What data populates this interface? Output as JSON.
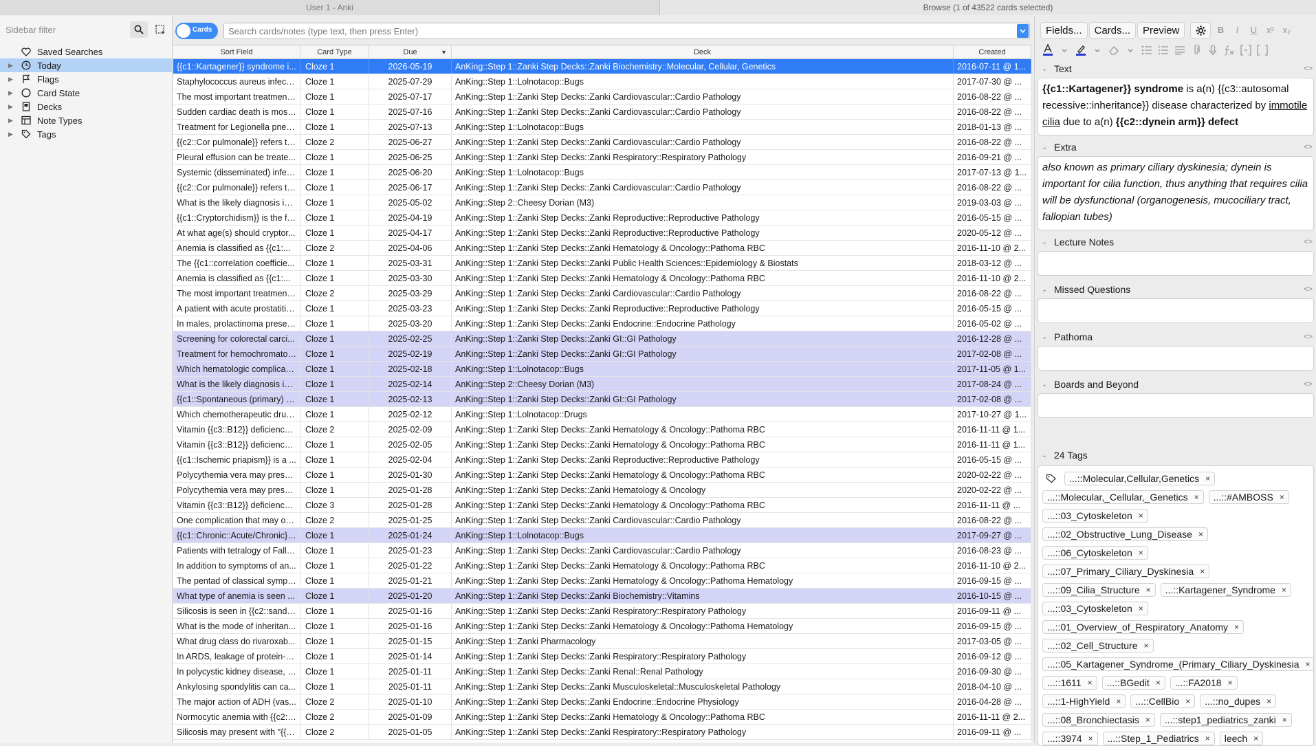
{
  "window": {
    "left_title": "User 1 - Anki",
    "right_title": "Browse (1 of 43522 cards selected)"
  },
  "sidebar": {
    "filter_placeholder": "Sidebar filter",
    "items": [
      {
        "label": "Saved Searches",
        "icon": "heart-icon",
        "arrow": false
      },
      {
        "label": "Today",
        "icon": "clock-icon",
        "arrow": true,
        "selected": true
      },
      {
        "label": "Flags",
        "icon": "flag-icon",
        "arrow": true
      },
      {
        "label": "Card State",
        "icon": "circle-icon",
        "arrow": true
      },
      {
        "label": "Decks",
        "icon": "deck-icon",
        "arrow": true
      },
      {
        "label": "Note Types",
        "icon": "note-types-icon",
        "arrow": true
      },
      {
        "label": "Tags",
        "icon": "tag-icon",
        "arrow": true
      }
    ]
  },
  "toolbar": {
    "toggle_label": "Cards",
    "search_placeholder": "Search cards/notes (type text, then press Enter)"
  },
  "table": {
    "columns": [
      "Sort Field",
      "Card Type",
      "Due",
      "Deck",
      "Created"
    ],
    "rows": [
      {
        "sort": "{{c1::Kartagener}} syndrome i...",
        "type": "Cloze 1",
        "due": "2026-05-19",
        "deck": "AnKing::Step 1::Zanki Step Decks::Zanki Biochemistry::Molecular, Cellular, Genetics",
        "created": "2016-07-11 @ 1...",
        "state": "sel"
      },
      {
        "sort": "Staphylococcus aureus infecti...",
        "type": "Cloze 1",
        "due": "2025-07-29",
        "deck": "AnKing::Step 1::Lolnotacop::Bugs",
        "created": "2017-07-30 @ ...",
        "state": ""
      },
      {
        "sort": "The most important treatment ...",
        "type": "Cloze 1",
        "due": "2025-07-17",
        "deck": "AnKing::Step 1::Zanki Step Decks::Zanki Cardiovascular::Cardio Pathology",
        "created": "2016-08-22 @ ...",
        "state": ""
      },
      {
        "sort": "Sudden cardiac death is most...",
        "type": "Cloze 1",
        "due": "2025-07-16",
        "deck": "AnKing::Step 1::Zanki Step Decks::Zanki Cardiovascular::Cardio Pathology",
        "created": "2016-08-22 @ ...",
        "state": ""
      },
      {
        "sort": "Treatment for Legionella pneu...",
        "type": "Cloze 1",
        "due": "2025-07-13",
        "deck": "AnKing::Step 1::Lolnotacop::Bugs",
        "created": "2018-01-13 @ ...",
        "state": ""
      },
      {
        "sort": "{{c2::Cor pulmonale}} refers to...",
        "type": "Cloze 2",
        "due": "2025-06-27",
        "deck": "AnKing::Step 1::Zanki Step Decks::Zanki Cardiovascular::Cardio Pathology",
        "created": "2016-08-22 @ ...",
        "state": ""
      },
      {
        "sort": "Pleural effusion can be treate...",
        "type": "Cloze 1",
        "due": "2025-06-25",
        "deck": "AnKing::Step 1::Zanki Step Decks::Zanki Respiratory::Respiratory Pathology",
        "created": "2016-09-21 @ ...",
        "state": ""
      },
      {
        "sort": "Systemic (disseminated) infec...",
        "type": "Cloze 1",
        "due": "2025-06-20",
        "deck": "AnKing::Step 1::Lolnotacop::Bugs",
        "created": "2017-07-13 @ 1...",
        "state": ""
      },
      {
        "sort": "{{c2::Cor pulmonale}} refers to...",
        "type": "Cloze 1",
        "due": "2025-06-17",
        "deck": "AnKing::Step 1::Zanki Step Decks::Zanki Cardiovascular::Cardio Pathology",
        "created": "2016-08-22 @ ...",
        "state": ""
      },
      {
        "sort": "What is the likely diagnosis in ...",
        "type": "Cloze 1",
        "due": "2025-05-02",
        "deck": "AnKing::Step 2::Cheesy Dorian (M3)",
        "created": "2019-03-03 @ ...",
        "state": ""
      },
      {
        "sort": "{{c1::Cryptorchidism}} is the fa...",
        "type": "Cloze 1",
        "due": "2025-04-19",
        "deck": "AnKing::Step 1::Zanki Step Decks::Zanki Reproductive::Reproductive Pathology",
        "created": "2016-05-15 @ ...",
        "state": ""
      },
      {
        "sort": "At what age(s) should cryptor...",
        "type": "Cloze 1",
        "due": "2025-04-17",
        "deck": "AnKing::Step 1::Zanki Step Decks::Zanki Reproductive::Reproductive Pathology",
        "created": "2020-05-12 @ ...",
        "state": ""
      },
      {
        "sort": "Anemia is classified as {{c1:...",
        "type": "Cloze 2",
        "due": "2025-04-06",
        "deck": "AnKing::Step 1::Zanki Step Decks::Zanki Hematology & Oncology::Pathoma RBC",
        "created": "2016-11-10 @ 2...",
        "state": ""
      },
      {
        "sort": "The {{c1::correlation coefficie...",
        "type": "Cloze 1",
        "due": "2025-03-31",
        "deck": "AnKing::Step 1::Zanki Step Decks::Zanki Public Health Sciences::Epidemiology & Biostats",
        "created": "2018-03-12 @ ...",
        "state": ""
      },
      {
        "sort": "Anemia is classified as {{c1:...",
        "type": "Cloze 1",
        "due": "2025-03-30",
        "deck": "AnKing::Step 1::Zanki Step Decks::Zanki Hematology & Oncology::Pathoma RBC",
        "created": "2016-11-10 @ 2...",
        "state": ""
      },
      {
        "sort": "The most important treatment ...",
        "type": "Cloze 2",
        "due": "2025-03-29",
        "deck": "AnKing::Step 1::Zanki Step Decks::Zanki Cardiovascular::Cardio Pathology",
        "created": "2016-08-22 @ ...",
        "state": ""
      },
      {
        "sort": "A patient with acute prostatitis...",
        "type": "Cloze 1",
        "due": "2025-03-23",
        "deck": "AnKing::Step 1::Zanki Step Decks::Zanki Reproductive::Reproductive Pathology",
        "created": "2016-05-15 @ ...",
        "state": ""
      },
      {
        "sort": "In males, prolactinoma presen...",
        "type": "Cloze 1",
        "due": "2025-03-20",
        "deck": "AnKing::Step 1::Zanki Step Decks::Zanki Endocrine::Endocrine Pathology",
        "created": "2016-05-02 @ ...",
        "state": ""
      },
      {
        "sort": "Screening for colorectal carci...",
        "type": "Cloze 1",
        "due": "2025-02-25",
        "deck": "AnKing::Step 1::Zanki Step Decks::Zanki GI::GI Pathology",
        "created": "2016-12-28 @ ...",
        "state": "hl"
      },
      {
        "sort": "Treatment for hemochromatos...",
        "type": "Cloze 1",
        "due": "2025-02-19",
        "deck": "AnKing::Step 1::Zanki Step Decks::Zanki GI::GI Pathology",
        "created": "2017-02-08 @ ...",
        "state": "hl"
      },
      {
        "sort": "Which hematologic complicati...",
        "type": "Cloze 1",
        "due": "2025-02-18",
        "deck": "AnKing::Step 1::Lolnotacop::Bugs",
        "created": "2017-11-05 @ 1...",
        "state": "hl"
      },
      {
        "sort": "What is the likely diagnosis in ...",
        "type": "Cloze 1",
        "due": "2025-02-14",
        "deck": "AnKing::Step 2::Cheesy Dorian (M3)",
        "created": "2017-08-24 @ ...",
        "state": "hl"
      },
      {
        "sort": "{{c1::Spontaneous (primary) b...",
        "type": "Cloze 1",
        "due": "2025-02-13",
        "deck": "AnKing::Step 1::Zanki Step Decks::Zanki GI::GI Pathology",
        "created": "2017-02-08 @ ...",
        "state": "hl"
      },
      {
        "sort": "Which chemotherapeutic drug...",
        "type": "Cloze 1",
        "due": "2025-02-12",
        "deck": "AnKing::Step 1::Lolnotacop::Drugs",
        "created": "2017-10-27 @ 1...",
        "state": ""
      },
      {
        "sort": "Vitamin {{c3::B12}} deficiency ...",
        "type": "Cloze 2",
        "due": "2025-02-09",
        "deck": "AnKing::Step 1::Zanki Step Decks::Zanki Hematology & Oncology::Pathoma RBC",
        "created": "2016-11-11 @ 1...",
        "state": ""
      },
      {
        "sort": "Vitamin {{c3::B12}} deficiency ...",
        "type": "Cloze 1",
        "due": "2025-02-05",
        "deck": "AnKing::Step 1::Zanki Step Decks::Zanki Hematology & Oncology::Pathoma RBC",
        "created": "2016-11-11 @ 1...",
        "state": ""
      },
      {
        "sort": "{{c1::Ischemic priapism}} is a ...",
        "type": "Cloze 1",
        "due": "2025-02-04",
        "deck": "AnKing::Step 1::Zanki Step Decks::Zanki Reproductive::Reproductive Pathology",
        "created": "2016-05-15 @ ...",
        "state": ""
      },
      {
        "sort": "Polycythemia vera may prese...",
        "type": "Cloze 1",
        "due": "2025-01-30",
        "deck": "AnKing::Step 1::Zanki Step Decks::Zanki Hematology & Oncology::Pathoma RBC",
        "created": "2020-02-22 @ ...",
        "state": ""
      },
      {
        "sort": "Polycythemia vera may prese...",
        "type": "Cloze 1",
        "due": "2025-01-28",
        "deck": "AnKing::Step 1::Zanki Step Decks::Zanki Hematology & Oncology",
        "created": "2020-02-22 @ ...",
        "state": ""
      },
      {
        "sort": "Vitamin {{c3::B12}} deficiency ...",
        "type": "Cloze 3",
        "due": "2025-01-28",
        "deck": "AnKing::Step 1::Zanki Step Decks::Zanki Hematology & Oncology::Pathoma RBC",
        "created": "2016-11-11 @ ...",
        "state": ""
      },
      {
        "sort": "One complication that may oc...",
        "type": "Cloze 2",
        "due": "2025-01-25",
        "deck": "AnKing::Step 1::Zanki Step Decks::Zanki Cardiovascular::Cardio Pathology",
        "created": "2016-08-22 @ ...",
        "state": ""
      },
      {
        "sort": "{{c1::Chronic::Acute/Chronic}}...",
        "type": "Cloze 1",
        "due": "2025-01-24",
        "deck": "AnKing::Step 1::Lolnotacop::Bugs",
        "created": "2017-09-27 @ ...",
        "state": "hl"
      },
      {
        "sort": "Patients with tetralogy of Fallo...",
        "type": "Cloze 1",
        "due": "2025-01-23",
        "deck": "AnKing::Step 1::Zanki Step Decks::Zanki Cardiovascular::Cardio Pathology",
        "created": "2016-08-23 @ ...",
        "state": ""
      },
      {
        "sort": "In addition to symptoms of an...",
        "type": "Cloze 1",
        "due": "2025-01-22",
        "deck": "AnKing::Step 1::Zanki Step Decks::Zanki Hematology & Oncology::Pathoma RBC",
        "created": "2016-11-10 @ 2...",
        "state": ""
      },
      {
        "sort": "The pentad of classical sympt...",
        "type": "Cloze 1",
        "due": "2025-01-21",
        "deck": "AnKing::Step 1::Zanki Step Decks::Zanki Hematology & Oncology::Pathoma Hematology",
        "created": "2016-09-15 @ ...",
        "state": ""
      },
      {
        "sort": "What type of anemia is seen ...",
        "type": "Cloze 1",
        "due": "2025-01-20",
        "deck": "AnKing::Step 1::Zanki Step Decks::Zanki Biochemistry::Vitamins",
        "created": "2016-10-15 @ ...",
        "state": "hl"
      },
      {
        "sort": "Silicosis is seen in {{c2::sandb...",
        "type": "Cloze 1",
        "due": "2025-01-16",
        "deck": "AnKing::Step 1::Zanki Step Decks::Zanki Respiratory::Respiratory Pathology",
        "created": "2016-09-11 @ ...",
        "state": ""
      },
      {
        "sort": "What is the mode of inheritan...",
        "type": "Cloze 1",
        "due": "2025-01-16",
        "deck": "AnKing::Step 1::Zanki Step Decks::Zanki Hematology & Oncology::Pathoma Hematology",
        "created": "2016-09-15 @ ...",
        "state": ""
      },
      {
        "sort": "What drug class do rivaroxab...",
        "type": "Cloze 1",
        "due": "2025-01-15",
        "deck": "AnKing::Step 1::Zanki Pharmacology",
        "created": "2017-03-05 @ ...",
        "state": ""
      },
      {
        "sort": "In ARDS, leakage of protein-ri...",
        "type": "Cloze 1",
        "due": "2025-01-14",
        "deck": "AnKing::Step 1::Zanki Step Decks::Zanki Respiratory::Respiratory Pathology",
        "created": "2016-09-12 @ ...",
        "state": ""
      },
      {
        "sort": "In polycystic kidney disease, c...",
        "type": "Cloze 1",
        "due": "2025-01-11",
        "deck": "AnKing::Step 1::Zanki Step Decks::Zanki Renal::Renal Pathology",
        "created": "2016-09-30 @ ...",
        "state": ""
      },
      {
        "sort": "Ankylosing spondylitis can ca...",
        "type": "Cloze 1",
        "due": "2025-01-11",
        "deck": "AnKing::Step 1::Zanki Step Decks::Zanki Musculoskeletal::Musculoskeletal Pathology",
        "created": "2018-04-10 @ ...",
        "state": ""
      },
      {
        "sort": "The major action of ADH (vas...",
        "type": "Cloze 2",
        "due": "2025-01-10",
        "deck": "AnKing::Step 1::Zanki Step Decks::Zanki Endocrine::Endocrine Physiology",
        "created": "2016-04-28 @ ...",
        "state": ""
      },
      {
        "sort": "Normocytic anemia with {{c2::i...",
        "type": "Cloze 2",
        "due": "2025-01-09",
        "deck": "AnKing::Step 1::Zanki Step Decks::Zanki Hematology & Oncology::Pathoma RBC",
        "created": "2016-11-11 @ 2...",
        "state": ""
      },
      {
        "sort": "Silicosis may present with \"{{c...",
        "type": "Cloze 2",
        "due": "2025-01-05",
        "deck": "AnKing::Step 1::Zanki Step Decks::Zanki Respiratory::Respiratory Pathology",
        "created": "2016-09-11 @ ...",
        "state": ""
      }
    ]
  },
  "editor": {
    "buttons": [
      "Fields...",
      "Cards...",
      "Preview"
    ],
    "format_buttons": [
      "B",
      "I",
      "U",
      "x²",
      "x₂"
    ],
    "fields": [
      {
        "name": "Text",
        "content": ""
      },
      {
        "name": "Extra",
        "content": "also known as primary ciliary dyskinesia; dynein is important for cilia function, thus anything that requires cilia will be dysfunctional (organogenesis, mucociliary tract, fallopian tubes)"
      },
      {
        "name": "Lecture Notes",
        "content": ""
      },
      {
        "name": "Missed Questions",
        "content": ""
      },
      {
        "name": "Pathoma",
        "content": ""
      },
      {
        "name": "Boards and Beyond",
        "content": ""
      }
    ],
    "text_field": {
      "p1": "{{c1::Kartagener}} syndrome",
      "p2": " is a(n) {{c3::autosomal recessive::inheritance}} disease characterized by ",
      "p3": "immotile cilia",
      "p4": " due to a(n) ",
      "p5": "{{c2::dynein arm}} defect"
    },
    "code_toggle": "<>",
    "tags_label": "24 Tags",
    "tags": [
      "...::Molecular,Cellular,Genetics",
      "...::Molecular,_Cellular,_Genetics",
      "...::#AMBOSS",
      "...::03_Cytoskeleton",
      "...::02_Obstructive_Lung_Disease",
      "...::06_Cytoskeleton",
      "...::07_Primary_Ciliary_Dyskinesia",
      "...::09_Cilia_Structure",
      "...::Kartagener_Syndrome",
      "...::03_Cytoskeleton",
      "...::01_Overview_of_Respiratory_Anatomy",
      "...::02_Cell_Structure",
      "...::05_Kartagener_Syndrome_(Primary_Ciliary_Dyskinesia",
      "...::1611",
      "...::BGedit",
      "...::FA2018",
      "...::1-HighYield",
      "...::CellBio",
      "...::no_dupes",
      "...::08_Bronchiectasis",
      "...::step1_pediatrics_zanki",
      "...::3974",
      "...::Step_1_Pediatrics",
      "leech"
    ],
    "tag_remove_glyph": "×"
  },
  "colors": {
    "selected_row": "#2f7cf6",
    "highlight_row": "#d4d4f6",
    "accent": "#3d8bf5"
  }
}
